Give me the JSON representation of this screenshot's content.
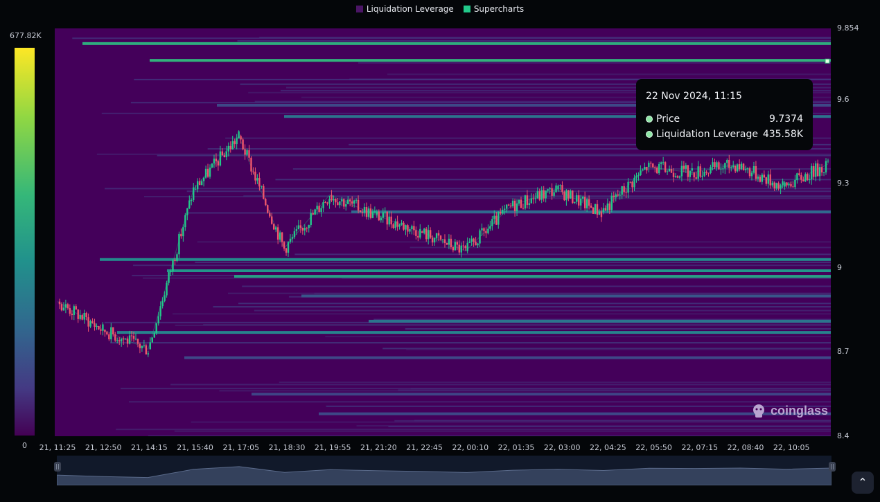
{
  "legend": {
    "items": [
      {
        "label": "Liquidation Leverage",
        "color": "#4b1566"
      },
      {
        "label": "Supercharts",
        "color": "#22c98a"
      }
    ]
  },
  "colorbar": {
    "max_label": "677.82K",
    "min_label": "0"
  },
  "tooltip": {
    "date": "22 Nov 2024, 11:15",
    "rows": [
      {
        "label": "Price",
        "value": "9.7374"
      },
      {
        "label": "Liquidation Leverage",
        "value": "435.58K"
      }
    ]
  },
  "watermark": {
    "text": "coinglass"
  },
  "chart_data": {
    "type": "heatmap",
    "title": "",
    "legend": [
      "Liquidation Leverage",
      "Supercharts"
    ],
    "legend_position": "top-center",
    "colorscale": "viridis",
    "value_range": [
      0,
      677820
    ],
    "colors": {
      "up": "#22c98a",
      "down": "#f0556b",
      "background": "#44005a"
    },
    "x_ticks": [
      "21, 11:25",
      "21, 12:50",
      "21, 14:15",
      "21, 15:40",
      "21, 17:05",
      "21, 18:30",
      "21, 19:55",
      "21, 21:20",
      "21, 22:45",
      "22, 00:10",
      "22, 01:35",
      "22, 03:00",
      "22, 04:25",
      "22, 05:50",
      "22, 07:15",
      "22, 08:40",
      "22, 10:05"
    ],
    "y_ticks": [
      "9.854",
      "9.6",
      "9.3",
      "9",
      "8.7",
      "8.4"
    ],
    "ylim": [
      8.4,
      9.854
    ],
    "price_series": {
      "name": "Supercharts",
      "x": [
        "21, 11:25",
        "21, 12:50",
        "21, 14:15",
        "21, 15:40",
        "21, 17:05",
        "21, 18:30",
        "21, 19:55",
        "21, 21:20",
        "21, 22:45",
        "22, 00:10",
        "22, 01:35",
        "22, 03:00",
        "22, 04:25",
        "22, 05:50",
        "22, 07:15",
        "22, 08:40",
        "22, 10:05",
        "22, 11:15"
      ],
      "y": [
        8.88,
        8.78,
        8.71,
        9.28,
        9.47,
        9.07,
        9.26,
        9.19,
        9.13,
        9.06,
        9.22,
        9.28,
        9.2,
        9.36,
        9.34,
        9.37,
        9.29,
        9.37
      ]
    },
    "liquidation_levels": [
      {
        "price": 9.8,
        "value": 420000
      },
      {
        "price": 9.74,
        "value": 435580
      },
      {
        "price": 9.58,
        "value": 150000
      },
      {
        "price": 9.54,
        "value": 260000
      },
      {
        "price": 9.2,
        "value": 230000
      },
      {
        "price": 9.03,
        "value": 320000
      },
      {
        "price": 8.99,
        "value": 350000
      },
      {
        "price": 8.97,
        "value": 380000
      },
      {
        "price": 8.9,
        "value": 180000
      },
      {
        "price": 8.81,
        "value": 260000
      },
      {
        "price": 8.77,
        "value": 300000
      },
      {
        "price": 8.68,
        "value": 150000
      },
      {
        "price": 8.55,
        "value": 140000
      },
      {
        "price": 8.48,
        "value": 150000
      }
    ],
    "tooltip_point": {
      "x": "22 Nov 2024, 11:15",
      "price": 9.7374,
      "liquidation_leverage": 435580
    }
  }
}
